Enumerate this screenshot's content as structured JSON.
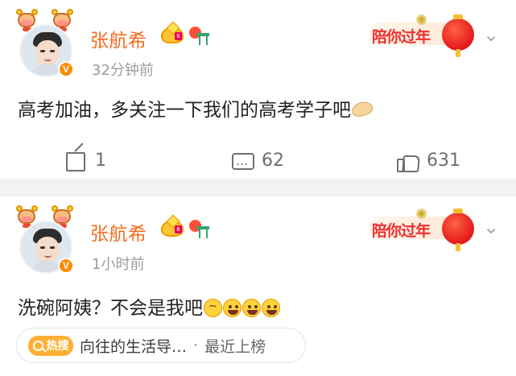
{
  "posts": [
    {
      "author": "张航希",
      "time": "32分钟前",
      "verified_mark": "V",
      "crown_number": "6",
      "newyear_badge": "陪你过年",
      "text": "高考加油，多关注一下我们的高考学子吧",
      "actions": {
        "share": "1",
        "comment": "62",
        "like": "631"
      }
    },
    {
      "author": "张航希",
      "time": "1小时前",
      "verified_mark": "V",
      "crown_number": "6",
      "newyear_badge": "陪你过年",
      "text": "洗碗阿姨？不会是我吧",
      "hot_search": {
        "logo": "热搜",
        "title": "向往的生活导…",
        "separator": "·",
        "rank": "最近上榜"
      }
    }
  ],
  "icons": {
    "share": "share-icon",
    "comment": "comment-icon",
    "like": "like-icon",
    "more": "chevron-down-icon"
  },
  "colors": {
    "name": "#f36b1c",
    "newyear": "#ef2e2e",
    "muted": "#9c9c9c",
    "divider": "#f2f2f2"
  }
}
